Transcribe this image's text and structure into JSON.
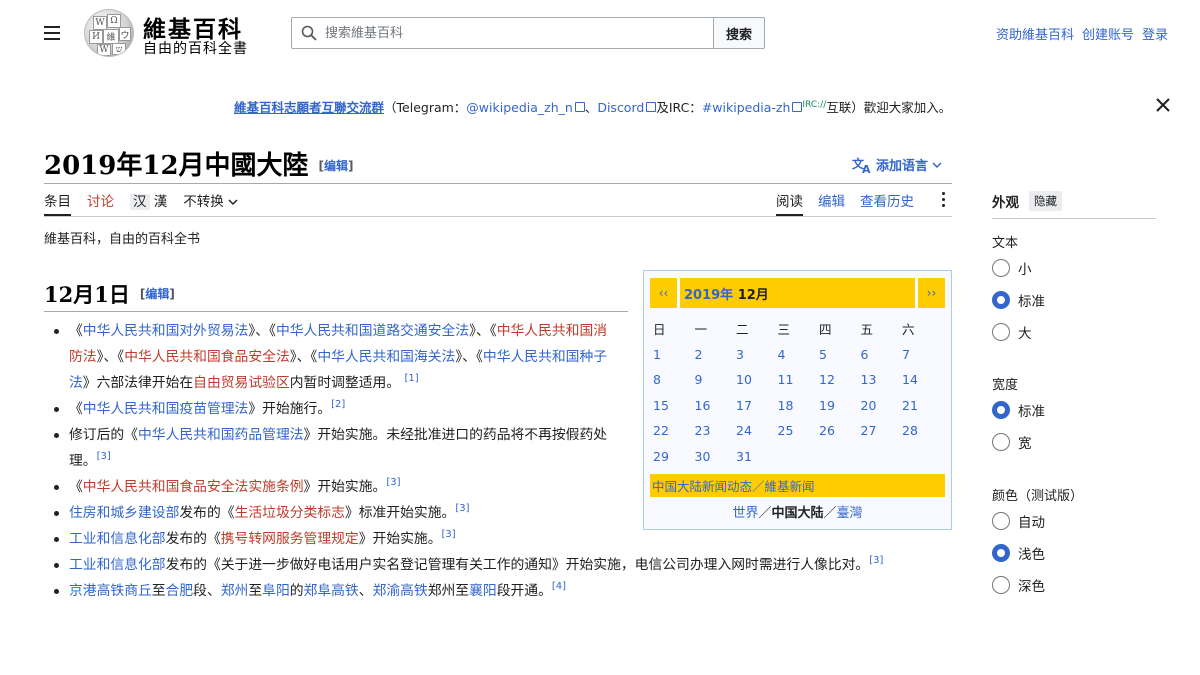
{
  "header": {
    "wordmark": "維基百科",
    "tagline": "自由的百科全書",
    "search_placeholder": "搜索維基百科",
    "search_button": "搜索",
    "user_links": [
      "资助維基百科",
      "创建账号",
      "登录"
    ]
  },
  "banner": {
    "group": "維基百科志願者互聯交流群",
    "p1": "（Telegram：",
    "telegram": "@wikipedia_zh_n",
    "p2": "、",
    "discord": "Discord",
    "p3": "及IRC：",
    "irc": "#wikipedia-zh",
    "sup": "IRC://",
    "p4": "互联）歡迎大家加入。"
  },
  "title": {
    "text": "2019年12月中國大陸",
    "edit_open": "[",
    "edit": "编辑",
    "edit_close": "]"
  },
  "add_language": "添加语言",
  "tabs": {
    "article": "条目",
    "talk": "讨论",
    "variant_simp": "汉",
    "variant_trad": "漢",
    "convert": "不转换",
    "read": "阅读",
    "edit": "编辑",
    "history": "查看历史"
  },
  "site_sub": "維基百科，自由的百科全书",
  "section": {
    "heading": "12月1日",
    "edit": "编辑"
  },
  "news": {
    "i1": {
      "a": "《",
      "b": "中华人民共和国对外贸易法",
      "c": "》、《",
      "d": "中华人民共和国道路交通安全法",
      "e": "》、《",
      "f": "中华人民共和国消防法",
      "g": "》、《",
      "h": "中华人民共和国食品安全法",
      "i": "》、《",
      "j": "中华人民共和国海关法",
      "k": "》、《",
      "l": "中华人民共和国种子法",
      "m": "》六部法律开始在",
      "n": "自由贸易试验区",
      "o": "内暂时调整适用。",
      "ref": "[1]"
    },
    "i2": {
      "a": "《",
      "b": "中华人民共和国疫苗管理法",
      "c": "》开始施行。",
      "ref": "[2]"
    },
    "i3": {
      "a": "修订后的《",
      "b": "中华人民共和国药品管理法",
      "c": "》开始实施。未经批准进口的药品将不再按假药处理。",
      "ref": "[3]"
    },
    "i4": {
      "a": "《",
      "b": "中华人民共和国食品安全法实施条例",
      "c": "》开始实施。",
      "ref": "[3]"
    },
    "i5": {
      "a": "住房和城乡建设部",
      "b": "发布的《",
      "c": "生活垃圾分类标志",
      "d": "》标准开始实施。",
      "ref": "[3]"
    },
    "i6": {
      "a": "工业和信息化部",
      "b": "发布的《",
      "c": "携号转网服务管理规定",
      "d": "》开始实施。",
      "ref": "[3]"
    },
    "i7": {
      "a": "工业和信息化部",
      "b": "发布的《关于进一步做好电话用户实名登记管理有关工作的通知》开始实施，电信公司办理入网时需进行人像比对。",
      "ref": "[3]"
    },
    "i8": {
      "a": "京港高铁",
      "b": "商丘",
      "c": "至",
      "d": "合肥",
      "e": "段、",
      "f": "郑州",
      "g": "至",
      "h": "阜阳",
      "i": "的",
      "j": "郑阜高铁",
      "k": "、",
      "l": "郑渝高铁",
      "m": "郑州至",
      "n": "襄阳",
      "o": "段开通。",
      "ref": "[4]"
    }
  },
  "calendar": {
    "prev": "‹‹",
    "next": "››",
    "year": "2019年",
    "month": "12月",
    "weekdays": [
      "日",
      "一",
      "二",
      "三",
      "四",
      "五",
      "六"
    ],
    "days": [
      "1",
      "2",
      "3",
      "4",
      "5",
      "6",
      "7",
      "8",
      "9",
      "10",
      "11",
      "12",
      "13",
      "14",
      "15",
      "16",
      "17",
      "18",
      "19",
      "20",
      "21",
      "22",
      "23",
      "24",
      "25",
      "26",
      "27",
      "28",
      "29",
      "30",
      "31"
    ],
    "footer": "中国大陆新闻动态／維基新闻",
    "links": {
      "world": "世界",
      "sep1": "／",
      "mainland": "中国大陆",
      "sep2": "／",
      "taiwan": "臺灣"
    }
  },
  "appearance": {
    "title": "外观",
    "hide": "隐藏",
    "text_label": "文本",
    "text_options": [
      "小",
      "标准",
      "大"
    ],
    "text_selected": 1,
    "width_label": "宽度",
    "width_options": [
      "标准",
      "宽"
    ],
    "width_selected": 0,
    "color_label": "颜色（测试版）",
    "color_options": [
      "自动",
      "浅色",
      "深色"
    ],
    "color_selected": 1
  },
  "colors": {
    "link": "#3366cc",
    "redlink": "#bf3c2c",
    "calendar_accent": "#ffcc00"
  }
}
